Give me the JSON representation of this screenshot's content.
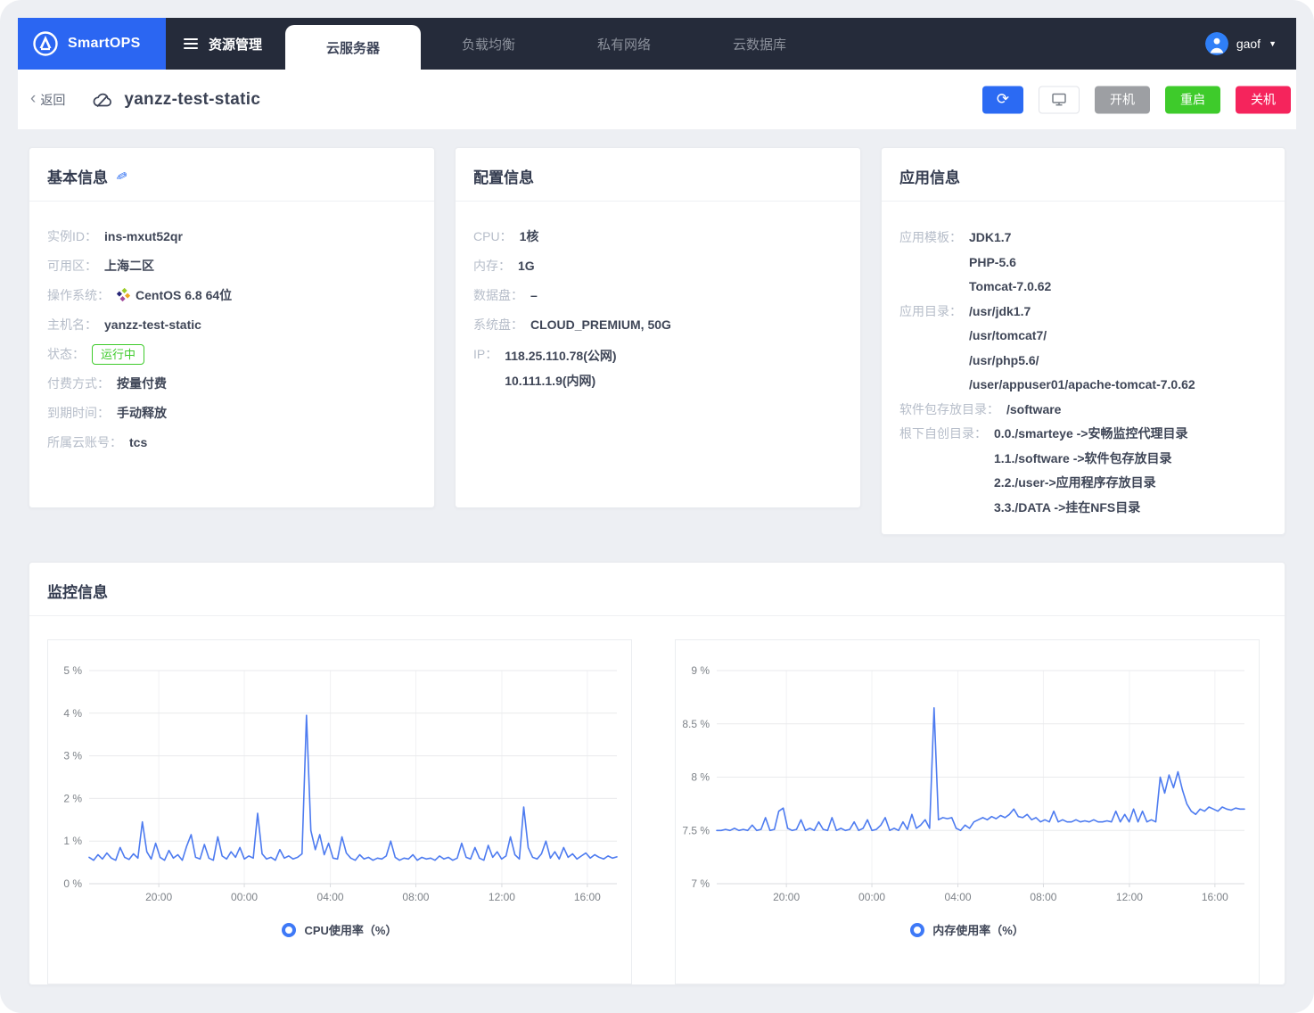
{
  "topbar": {
    "brand": "SmartOPS",
    "menu": "资源管理",
    "tabs": [
      {
        "label": "云服务器",
        "active": true
      },
      {
        "label": "负载均衡",
        "active": false
      },
      {
        "label": "私有网络",
        "active": false
      },
      {
        "label": "云数据库",
        "active": false
      }
    ],
    "user": "gaof"
  },
  "header": {
    "back": "返回",
    "title": "yanzz-test-static",
    "buttons": {
      "power_on": "开机",
      "restart": "重启",
      "shutdown": "关机"
    }
  },
  "cards": {
    "basic": {
      "title": "基本信息",
      "fields": [
        {
          "label": "实例ID：",
          "value": "ins-mxut52qr"
        },
        {
          "label": "可用区：",
          "value": "上海二区"
        },
        {
          "label": "操作系统：",
          "value": "CentOS 6.8 64位",
          "icon": "centos"
        },
        {
          "label": "主机名：",
          "value": "yanzz-test-static"
        },
        {
          "label": "状态：",
          "value": "运行中",
          "badge": true
        },
        {
          "label": "付费方式：",
          "value": "按量付费"
        },
        {
          "label": "到期时间：",
          "value": "手动释放"
        },
        {
          "label": "所属云账号：",
          "value": "tcs"
        }
      ]
    },
    "config": {
      "title": "配置信息",
      "fields": [
        {
          "label": "CPU：",
          "value": "1核"
        },
        {
          "label": "内存：",
          "value": "1G"
        },
        {
          "label": "数据盘：",
          "value": "–"
        },
        {
          "label": "系统盘：",
          "value": "CLOUD_PREMIUM, 50G"
        },
        {
          "label": "IP：",
          "lines": [
            "118.25.110.78(公网)",
            "10.111.1.9(内网)"
          ]
        }
      ]
    },
    "app": {
      "title": "应用信息",
      "fields": [
        {
          "label": "应用模板：",
          "lines": [
            "JDK1.7",
            "PHP-5.6",
            "Tomcat-7.0.62"
          ]
        },
        {
          "label": "应用目录：",
          "lines": [
            "/usr/jdk1.7",
            "/usr/tomcat7/",
            "/usr/php5.6/",
            "/user/appuser01/apache-tomcat-7.0.62"
          ]
        },
        {
          "label": "软件包存放目录：",
          "lines": [
            "/software"
          ]
        },
        {
          "label": "根下自创目录：",
          "lines": [
            "0.0./smarteye ->安畅监控代理目录",
            "1.1./software ->软件包存放目录",
            "2.2./user->应用程序存放目录",
            "3.3./DATA ->挂在NFS目录"
          ]
        }
      ]
    },
    "monitor": {
      "title": "监控信息"
    }
  },
  "colors": {
    "brand_blue": "#2b66f2",
    "navbar_dark": "#252b3a",
    "accent_blue": "#2b6af3",
    "green": "#3ecb2b",
    "red": "#f5245c",
    "gray_disabled": "#9d9fa3",
    "chart_line": "#4d7bf0",
    "page_bg": "#edeff3"
  },
  "chart_data": [
    {
      "type": "line",
      "name": "CPU使用率（%）",
      "color": "#4d7bf0",
      "ylim": [
        0,
        5
      ],
      "y_ticks": [
        0,
        1,
        2,
        3,
        4,
        5
      ],
      "y_tick_labels": [
        "0 %",
        "1 %",
        "2 %",
        "3 %",
        "4 %",
        "5 %"
      ],
      "x_tick_labels": [
        "20:00",
        "00:00",
        "04:00",
        "08:00",
        "12:00",
        "16:00"
      ],
      "x_tick_pos": [
        0.132,
        0.294,
        0.457,
        0.619,
        0.782,
        0.944
      ],
      "values": [
        0.62,
        0.55,
        0.68,
        0.58,
        0.72,
        0.6,
        0.55,
        0.85,
        0.62,
        0.57,
        0.7,
        0.6,
        1.45,
        0.75,
        0.58,
        0.95,
        0.62,
        0.55,
        0.78,
        0.6,
        0.68,
        0.55,
        0.88,
        1.15,
        0.62,
        0.58,
        0.92,
        0.6,
        0.55,
        1.1,
        0.65,
        0.58,
        0.75,
        0.62,
        0.85,
        0.58,
        0.65,
        0.6,
        1.65,
        0.7,
        0.58,
        0.62,
        0.55,
        0.8,
        0.6,
        0.65,
        0.58,
        0.62,
        0.7,
        3.95,
        1.25,
        0.8,
        1.15,
        0.68,
        0.95,
        0.6,
        0.58,
        1.1,
        0.72,
        0.6,
        0.55,
        0.68,
        0.58,
        0.62,
        0.55,
        0.6,
        0.58,
        0.65,
        1.0,
        0.62,
        0.55,
        0.6,
        0.58,
        0.68,
        0.55,
        0.62,
        0.58,
        0.6,
        0.55,
        0.65,
        0.58,
        0.62,
        0.55,
        0.6,
        0.95,
        0.62,
        0.58,
        0.85,
        0.6,
        0.55,
        0.9,
        0.62,
        0.75,
        0.58,
        0.65,
        1.1,
        0.68,
        0.58,
        1.8,
        0.85,
        0.62,
        0.58,
        0.7,
        1.0,
        0.6,
        0.75,
        0.58,
        0.85,
        0.62,
        0.7,
        0.58,
        0.65,
        0.72,
        0.6,
        0.68,
        0.62,
        0.58,
        0.65,
        0.6,
        0.63
      ]
    },
    {
      "type": "line",
      "name": "内存使用率（%）",
      "color": "#4d7bf0",
      "ylim": [
        7,
        9
      ],
      "y_ticks": [
        7,
        7.5,
        8,
        8.5,
        9
      ],
      "y_tick_labels": [
        "7 %",
        "7.5 %",
        "8 %",
        "8.5 %",
        "9 %"
      ],
      "x_tick_labels": [
        "20:00",
        "00:00",
        "04:00",
        "08:00",
        "12:00",
        "16:00"
      ],
      "x_tick_pos": [
        0.132,
        0.294,
        0.457,
        0.619,
        0.782,
        0.944
      ],
      "values": [
        7.5,
        7.5,
        7.51,
        7.5,
        7.52,
        7.5,
        7.51,
        7.5,
        7.55,
        7.5,
        7.51,
        7.62,
        7.5,
        7.51,
        7.68,
        7.71,
        7.52,
        7.5,
        7.51,
        7.6,
        7.5,
        7.52,
        7.5,
        7.58,
        7.51,
        7.5,
        7.62,
        7.5,
        7.52,
        7.5,
        7.51,
        7.58,
        7.5,
        7.52,
        7.6,
        7.5,
        7.51,
        7.55,
        7.62,
        7.5,
        7.52,
        7.5,
        7.58,
        7.51,
        7.65,
        7.52,
        7.55,
        7.6,
        7.52,
        8.65,
        7.6,
        7.62,
        7.61,
        7.62,
        7.52,
        7.5,
        7.55,
        7.52,
        7.58,
        7.6,
        7.62,
        7.6,
        7.63,
        7.61,
        7.64,
        7.62,
        7.65,
        7.7,
        7.63,
        7.62,
        7.65,
        7.6,
        7.62,
        7.58,
        7.6,
        7.58,
        7.68,
        7.58,
        7.6,
        7.58,
        7.58,
        7.6,
        7.58,
        7.59,
        7.58,
        7.6,
        7.58,
        7.58,
        7.59,
        7.58,
        7.68,
        7.58,
        7.65,
        7.58,
        7.7,
        7.58,
        7.68,
        7.58,
        7.6,
        7.58,
        8.0,
        7.85,
        8.02,
        7.9,
        8.05,
        7.88,
        7.75,
        7.68,
        7.65,
        7.7,
        7.68,
        7.72,
        7.7,
        7.68,
        7.72,
        7.7,
        7.69,
        7.71,
        7.7,
        7.7
      ]
    }
  ]
}
